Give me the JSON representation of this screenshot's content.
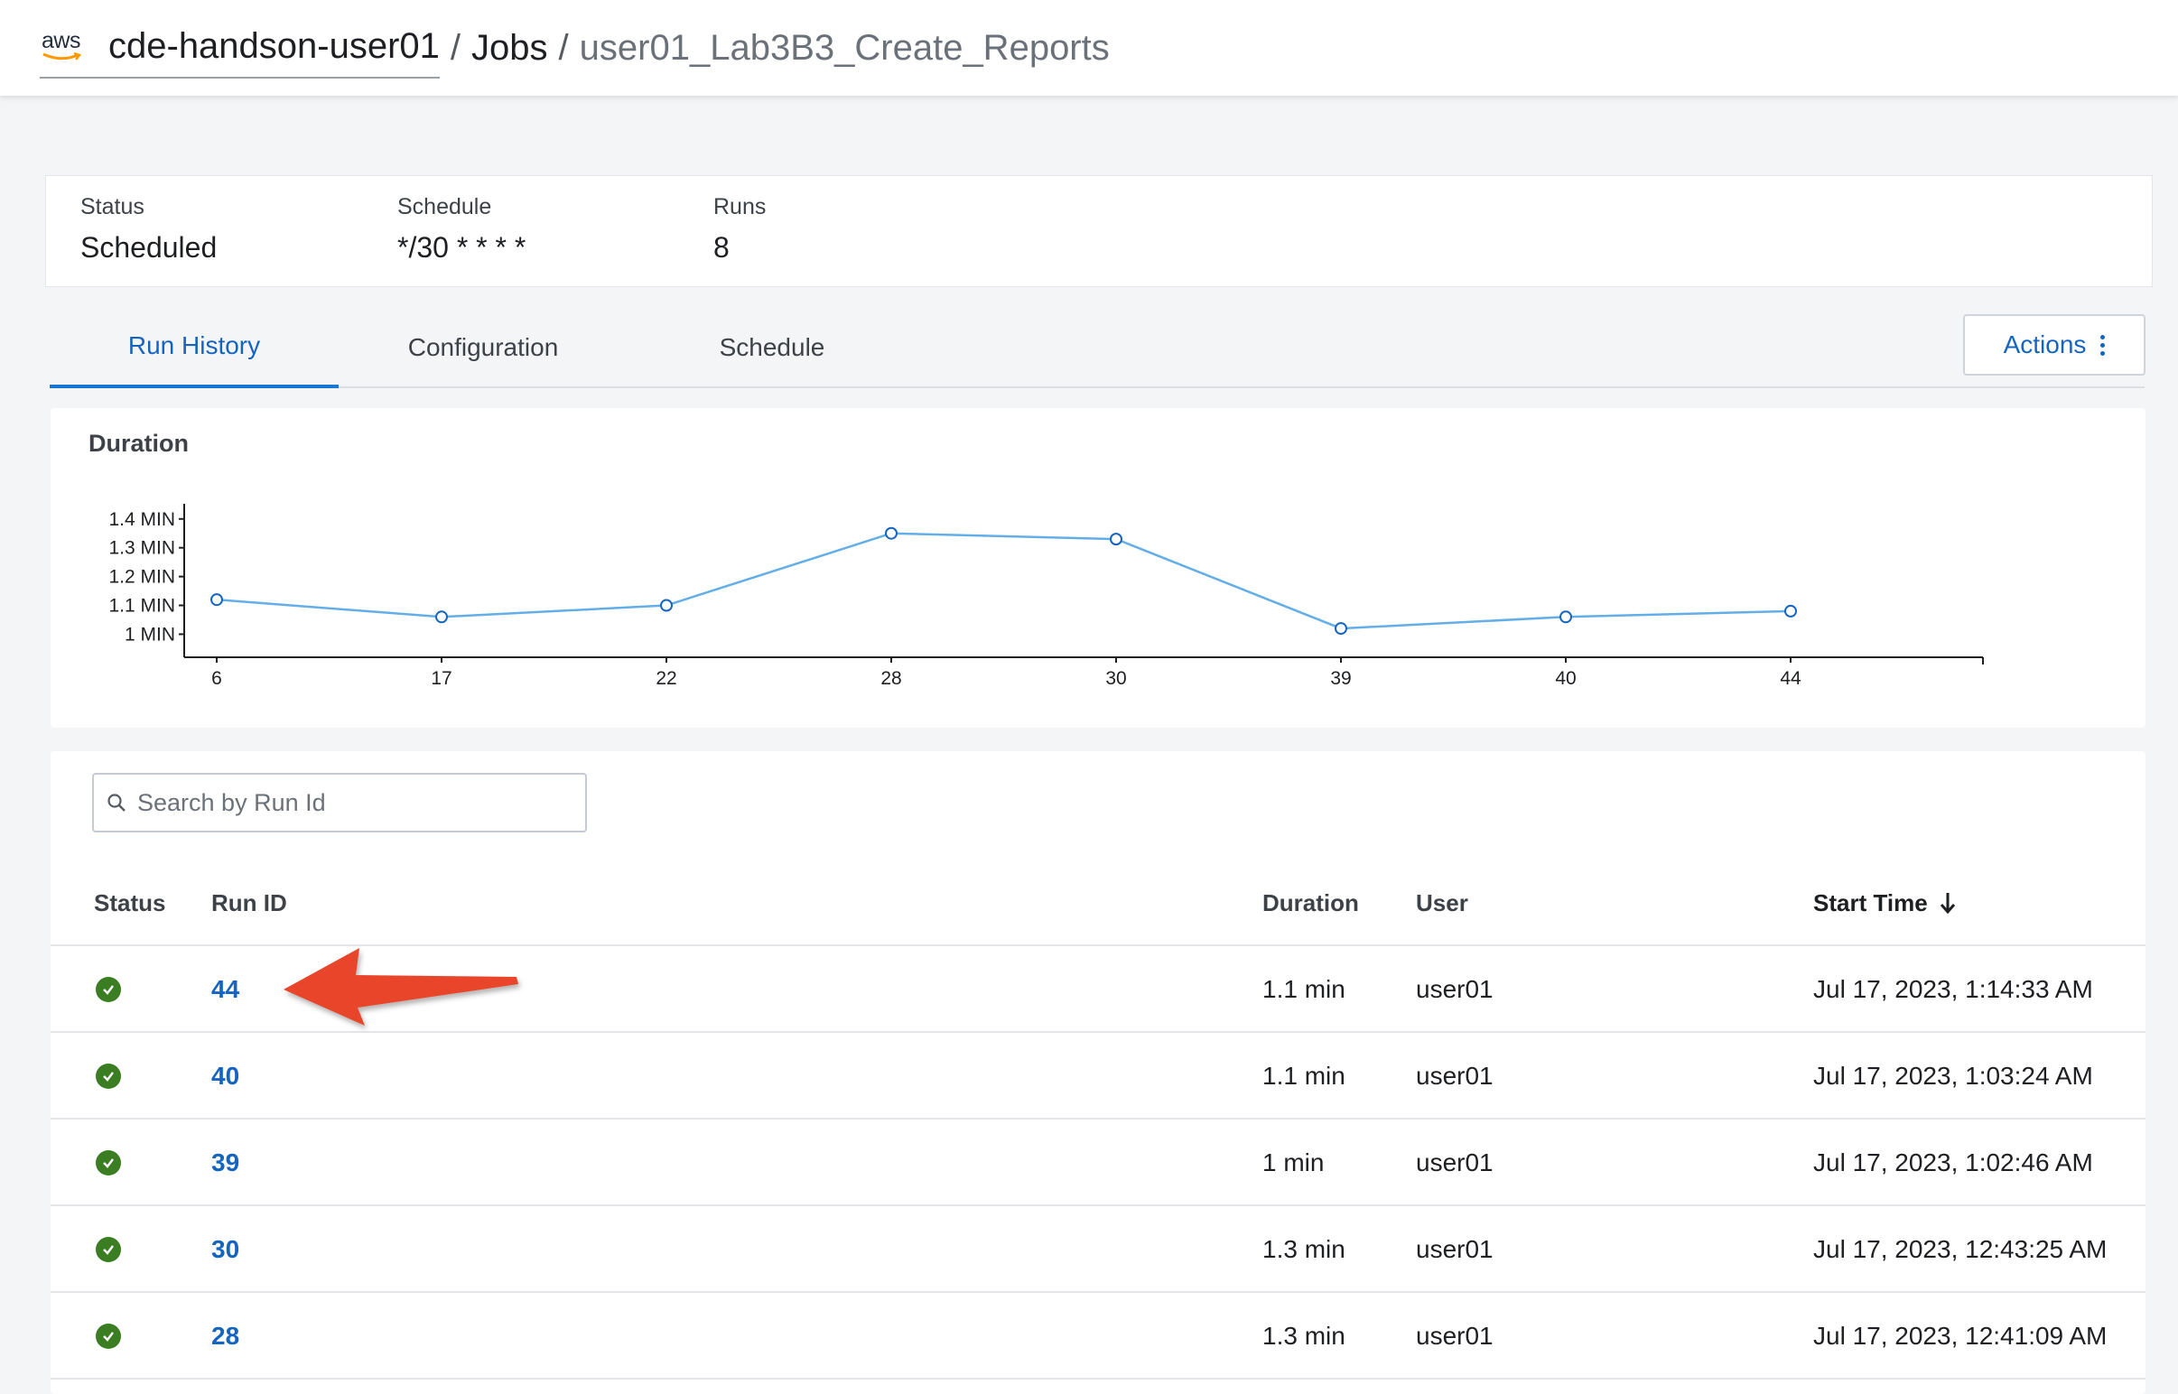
{
  "header": {
    "env_logo": "aws",
    "environment": "cde-handson-user01",
    "separator": "/",
    "jobs": "Jobs",
    "job_name": "user01_Lab3B3_Create_Reports"
  },
  "summary": {
    "status_label": "Status",
    "status_value": "Scheduled",
    "schedule_label": "Schedule",
    "schedule_value": "*/30 * * * *",
    "runs_label": "Runs",
    "runs_value": "8"
  },
  "tabs": [
    {
      "label": "Run History",
      "active": true
    },
    {
      "label": "Configuration",
      "active": false
    },
    {
      "label": "Schedule",
      "active": false
    }
  ],
  "actions_label": "Actions",
  "chart": {
    "title": "Duration",
    "line_color": "#64aee8"
  },
  "chart_data": {
    "type": "line",
    "title": "Duration",
    "xlabel": "",
    "ylabel": "",
    "categories": [
      "6",
      "17",
      "22",
      "28",
      "30",
      "39",
      "40",
      "44"
    ],
    "values": [
      1.12,
      1.06,
      1.1,
      1.35,
      1.33,
      1.02,
      1.06,
      1.08
    ],
    "y_ticks": [
      "1 MIN",
      "1.1 MIN",
      "1.2 MIN",
      "1.3 MIN",
      "1.4 MIN"
    ],
    "y_tick_values": [
      1.0,
      1.1,
      1.2,
      1.3,
      1.4
    ],
    "ylim": [
      0.92,
      1.44
    ],
    "grid": false
  },
  "table": {
    "search_placeholder": "Search by Run Id",
    "columns": {
      "status": "Status",
      "run_id": "Run ID",
      "duration": "Duration",
      "user": "User",
      "start_time": "Start Time"
    },
    "rows": [
      {
        "run_id": "44",
        "duration": "1.1 min",
        "user": "user01",
        "start_time": "Jul 17, 2023, 1:14:33 AM"
      },
      {
        "run_id": "40",
        "duration": "1.1 min",
        "user": "user01",
        "start_time": "Jul 17, 2023, 1:03:24 AM"
      },
      {
        "run_id": "39",
        "duration": "1 min",
        "user": "user01",
        "start_time": "Jul 17, 2023, 1:02:46 AM"
      },
      {
        "run_id": "30",
        "duration": "1.3 min",
        "user": "user01",
        "start_time": "Jul 17, 2023, 12:43:25 AM"
      },
      {
        "run_id": "28",
        "duration": "1.3 min",
        "user": "user01",
        "start_time": "Jul 17, 2023, 12:41:09 AM"
      }
    ]
  },
  "colors": {
    "accent": "#1565c0",
    "success": "#3b7d23",
    "annotation_arrow": "#e8452c"
  }
}
